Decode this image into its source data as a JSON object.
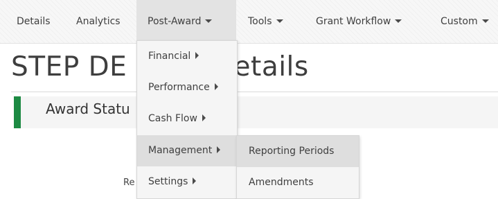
{
  "nav": {
    "items": [
      {
        "label": "Details"
      },
      {
        "label": "Analytics"
      },
      {
        "label": "Post-Award"
      },
      {
        "label": "Tools"
      },
      {
        "label": "Grant Workflow"
      },
      {
        "label": "Custom"
      }
    ]
  },
  "page": {
    "title": "STEP DE  ward Details",
    "status_label": "Award Statu",
    "partial_text": "Re"
  },
  "dropdown": {
    "items": [
      {
        "label": "Financial"
      },
      {
        "label": "Performance"
      },
      {
        "label": "Cash Flow"
      },
      {
        "label": "Management"
      },
      {
        "label": "Settings"
      }
    ]
  },
  "submenu": {
    "items": [
      {
        "label": "Reporting Periods"
      },
      {
        "label": "Amendments"
      }
    ]
  },
  "colors": {
    "status_accent": "#1d8a43",
    "active_background": "#e3e3e3"
  }
}
